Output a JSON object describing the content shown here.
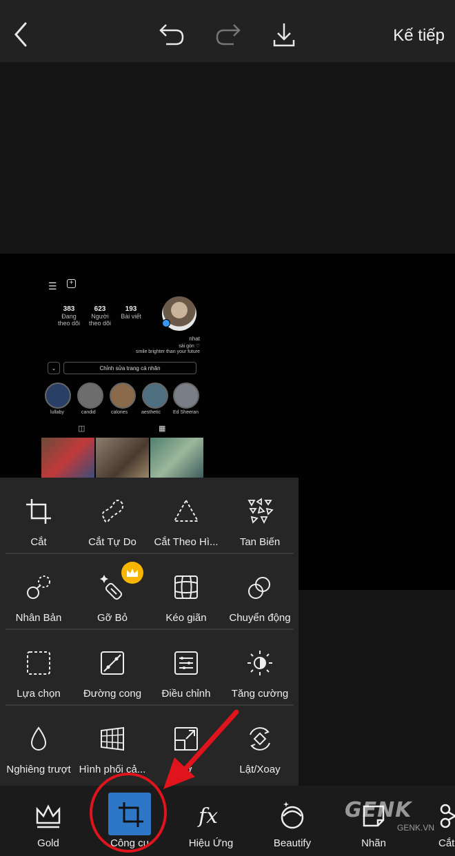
{
  "topbar": {
    "back_icon": "chevron-left-icon",
    "undo_icon": "undo-icon",
    "redo_icon": "redo-icon",
    "download_icon": "download-icon",
    "next_label": "Kế tiếp"
  },
  "photo": {
    "stats": [
      {
        "value": "383",
        "label": "Đang theo dõi"
      },
      {
        "value": "623",
        "label": "Người theo dõi"
      },
      {
        "value": "193",
        "label": "Bài viết"
      }
    ],
    "name": "nhat",
    "bio_line1": "sài gòn ♡",
    "bio_line2": "smile brighter than your future",
    "edit_profile": "Chỉnh sửa trang cá nhân",
    "highlights": [
      "lullaby",
      "candid",
      "calories",
      "aesthetic",
      "Ed Sheeran"
    ]
  },
  "tools": {
    "rows": [
      [
        {
          "label": "Cắt",
          "icon": "crop-icon"
        },
        {
          "label": "Cắt Tự Do",
          "icon": "freecut-icon"
        },
        {
          "label": "Cắt Theo Hì...",
          "icon": "shape-cut-icon"
        },
        {
          "label": "Tan Biến",
          "icon": "dispersion-icon"
        }
      ],
      [
        {
          "label": "Nhân Bản",
          "icon": "clone-icon"
        },
        {
          "label": "Gỡ Bỏ",
          "icon": "remove-icon"
        },
        {
          "label": "Kéo giãn",
          "icon": "stretch-icon"
        },
        {
          "label": "Chuyển động",
          "icon": "motion-icon"
        }
      ],
      [
        {
          "label": "Lựa chọn",
          "icon": "selection-icon"
        },
        {
          "label": "Đường cong",
          "icon": "curves-icon"
        },
        {
          "label": "Điều chỉnh",
          "icon": "adjust-icon"
        },
        {
          "label": "Tăng cường",
          "icon": "enhance-icon"
        }
      ],
      [
        {
          "label": "Nghiêng trượt",
          "icon": "tilt-shift-icon"
        },
        {
          "label": "Hình phối cả...",
          "icon": "perspective-icon"
        },
        {
          "label": "cỡ",
          "icon": "resize-icon"
        },
        {
          "label": "Lật/Xoay",
          "icon": "flip-rotate-icon"
        }
      ]
    ],
    "premium_badge_icon": "crown-icon"
  },
  "bottombar": {
    "items": [
      {
        "label": "Gold",
        "icon": "crown-icon"
      },
      {
        "label": "Công cụ",
        "icon": "crop-icon"
      },
      {
        "label": "Hiệu Ứng",
        "icon": "fx-icon"
      },
      {
        "label": "Beautify",
        "icon": "beautify-icon"
      },
      {
        "label": "Nhãn",
        "icon": "sticker-icon"
      },
      {
        "label": "Cắt",
        "icon": "cutout-icon"
      }
    ]
  },
  "watermark": {
    "text": "GENK",
    "sub": "GENK.VN"
  },
  "colors": {
    "accent": "#2d77c6",
    "highlight_ring": "#e0141c",
    "premium": "#f7b500"
  }
}
